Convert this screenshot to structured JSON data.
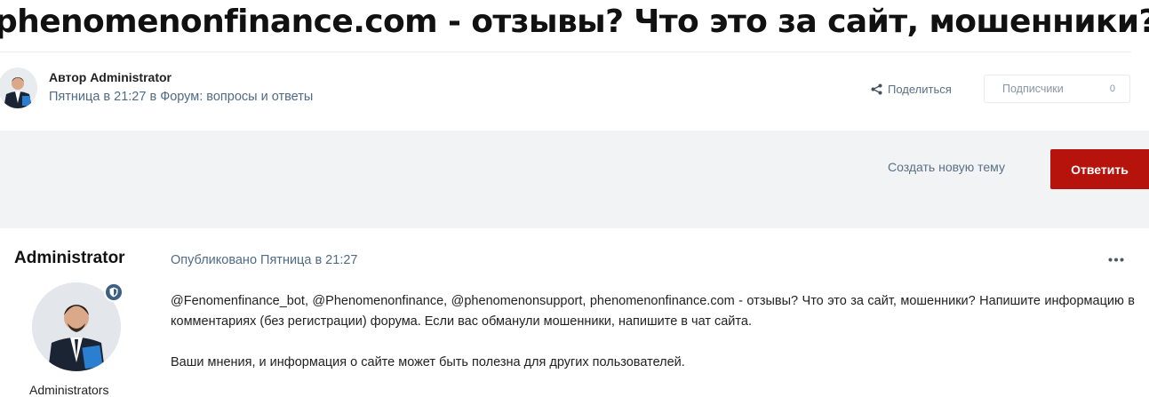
{
  "topic": {
    "title": "phenomenonfinance.com - отзывы? Что это за сайт, мошенники?",
    "author_line": "Автор Administrator",
    "meta_line": "Пятница в 21:27 в Форум: вопросы и ответы"
  },
  "actions": {
    "share_label": "Поделиться",
    "followers_label": "Подписчики",
    "followers_count": "0",
    "new_topic_label": "Создать новую тему",
    "reply_label": "Ответить"
  },
  "post": {
    "author_name": "Administrator",
    "author_group": "Administrators",
    "published": "Опубликовано Пятница в 21:27",
    "paragraph1": "@Fenomenfinance_bot, @Phenomenonfinance, @phenomenonsupport, phenomenonfinance.com - отзывы? Что это за сайт, мошенники? Напишите информацию в комментариях (без регистрации) форума. Если вас обманули мошенники, напишите в чат сайта.",
    "paragraph2": "Ваши мнения, и информация о сайте может быть полезна для других пользователей."
  },
  "icons": {
    "share": "share-icon",
    "more": "more-options-icon",
    "badge": "moderator-shield-icon"
  },
  "colors": {
    "accent": "#b7130d",
    "meta_text": "#4f6b85",
    "action_bar": "#f2f3f5",
    "badge": "#3c5f83"
  }
}
